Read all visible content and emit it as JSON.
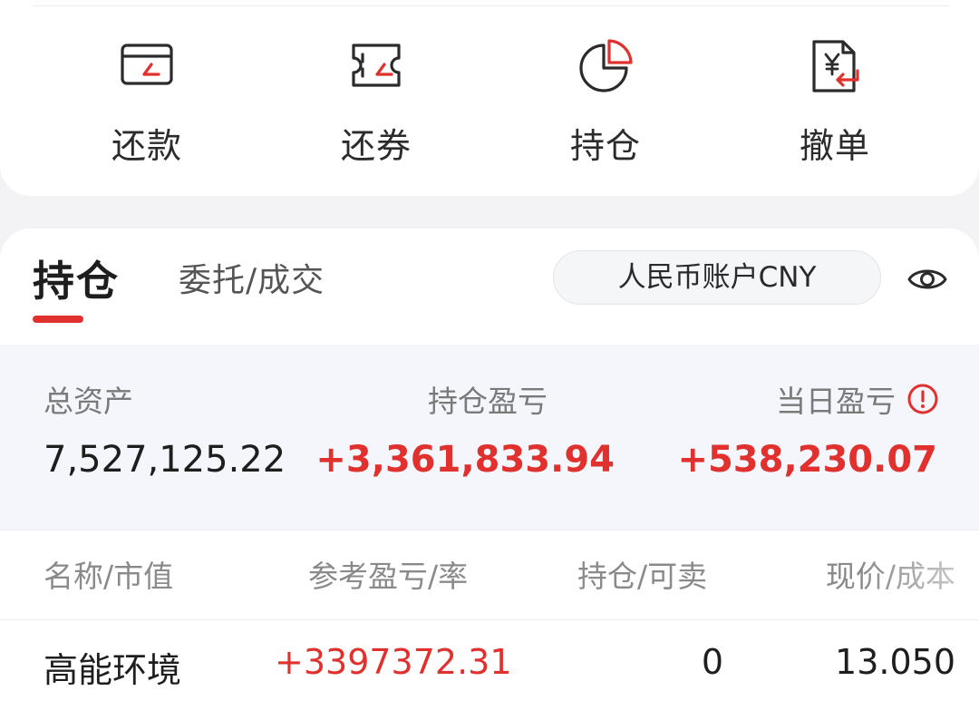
{
  "actions": [
    {
      "label": "还款",
      "icon": "repay-card-icon"
    },
    {
      "label": "还券",
      "icon": "return-ticket-icon"
    },
    {
      "label": "持仓",
      "icon": "pie-chart-icon"
    },
    {
      "label": "撤单",
      "icon": "cancel-order-document-icon"
    }
  ],
  "tabs": {
    "active": "持仓",
    "inactive": "委托/成交"
  },
  "account": {
    "label": "人民币账户CNY"
  },
  "summary": {
    "total_assets_label": "总资产",
    "total_assets_value": "7,527,125.22",
    "holding_pl_label": "持仓盈亏",
    "holding_pl_value": "+3,361,833.94",
    "today_pl_label": "当日盈亏",
    "today_pl_value": "+538,230.07"
  },
  "table": {
    "headers": [
      "名称/市值",
      "参考盈亏/率",
      "持仓/可卖",
      "现价/成本"
    ],
    "rows": [
      {
        "name": "高能环境",
        "pl": "+3397372.31",
        "holding": "0",
        "price": "13.050"
      }
    ]
  },
  "colors": {
    "accent_red": "#e0312f",
    "background": "#f3f3f5",
    "summary_bg": "#f4f6fb"
  }
}
